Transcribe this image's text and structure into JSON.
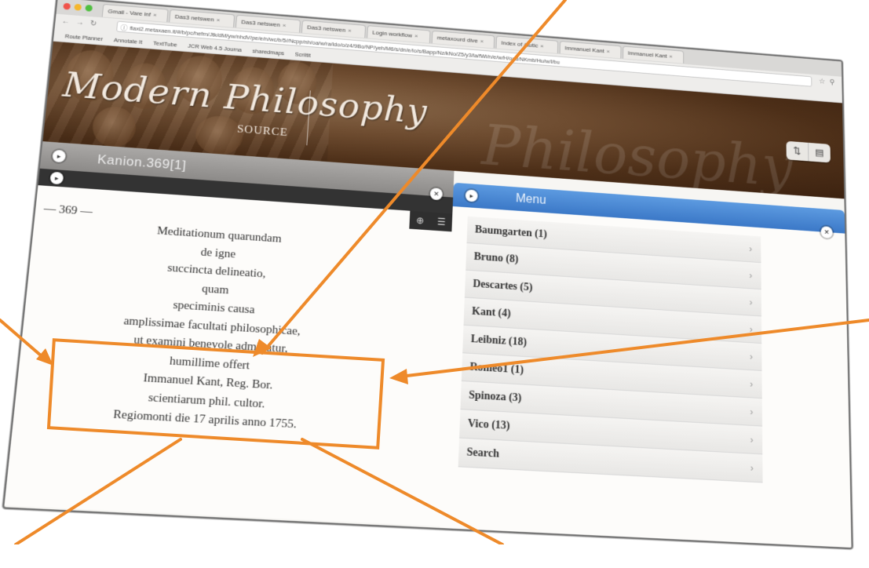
{
  "browser": {
    "tabs": [
      {
        "label": "Gmail - Vare inf"
      },
      {
        "label": "Das3 netswen"
      },
      {
        "label": "Das3 netswen"
      },
      {
        "label": "Das3 netswen"
      },
      {
        "label": "Login workflow"
      },
      {
        "label": "metaxourd dive"
      },
      {
        "label": "Index of /autic"
      },
      {
        "label": "Immanuel Kant"
      },
      {
        "label": "Immanuel Kant"
      }
    ],
    "url": "flaxi2.metaxaen.it/#/b/pc/hefrn/Jtk/dM/yw/nhdV/pe/e/n/wc/b/5//Ncpp/nh/oa/w/ra/ldo/o/z4/9Bo/NP/yeh/M6/s/dn/e/lo/s/Bapp/Nz/kNo/Z5/y3/la/fWi/n/e/w/H/ocd/NKmb/Hu/w/l/bu",
    "bookmarks": [
      "Route Planner",
      "Annotate It",
      "TextTube",
      "JCR Web 4.5 Journa",
      "sharedmaps",
      "Scriltit"
    ]
  },
  "header": {
    "brand_main": "Modern Philosophy",
    "brand_sub": "SOURCE",
    "watermark": "Philosophy"
  },
  "left_panel": {
    "title": "Kanion.369[1]",
    "page_number": "— 369 —",
    "lines": [
      "Meditationum quarundam",
      "de igne",
      "succincta delineatio,",
      "quam",
      "speciminis causa",
      "amplissimae facultati philosophicae,",
      "ut examini benevole admittatur,",
      "humillime offert",
      "Immanuel Kant, Reg. Bor.",
      "scientiarum phil. cultor.",
      "Regiomonti die 17 aprilis anno 1755."
    ]
  },
  "menu": {
    "title": "Menu",
    "items": [
      {
        "label": "Baumgarten (1)"
      },
      {
        "label": "Bruno (8)"
      },
      {
        "label": "Descartes (5)"
      },
      {
        "label": "Kant (4)"
      },
      {
        "label": "Leibniz (18)"
      },
      {
        "label": "Romeo1 (1)"
      },
      {
        "label": "Spinoza (3)"
      },
      {
        "label": "Vico (13)"
      },
      {
        "label": "Search"
      }
    ]
  },
  "colors": {
    "annotation_orange": "#ee8a2a",
    "menu_blue": "#3b78c7",
    "banner_brown": "#5a3a20"
  }
}
